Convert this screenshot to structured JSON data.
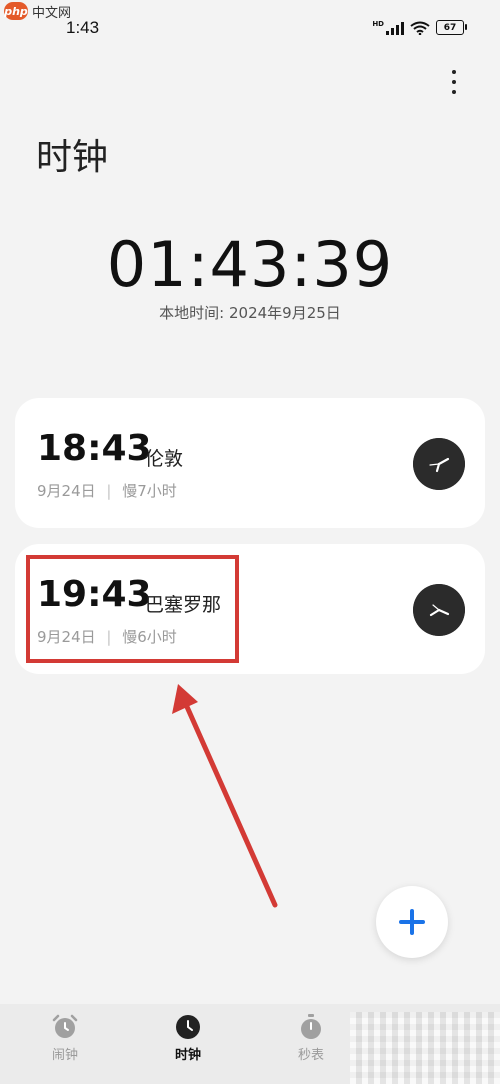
{
  "watermark": {
    "logo": "php",
    "text": "中文网"
  },
  "status_bar": {
    "time": "1:43",
    "hd": "HD",
    "battery": "67"
  },
  "header": {
    "title": "时钟",
    "more_icon": "more-vertical-icon"
  },
  "local_clock": {
    "time": "01:43:39",
    "date": "本地时间: 2024年9月25日"
  },
  "world_clocks": [
    {
      "time": "18:43",
      "city": "伦敦",
      "date": "9月24日",
      "separator": "|",
      "offset": "慢7小时"
    },
    {
      "time": "19:43",
      "city": "巴塞罗那",
      "date": "9月24日",
      "separator": "|",
      "offset": "慢6小时"
    }
  ],
  "add_button": {
    "icon": "plus-icon"
  },
  "colors": {
    "accent": "#1a73e8",
    "annotation": "#d33a35",
    "background": "#f3f3f3",
    "card": "#ffffff"
  },
  "bottom_nav": [
    {
      "label": "闹钟",
      "icon": "alarm-clock-icon",
      "active": false
    },
    {
      "label": "时钟",
      "icon": "clock-icon",
      "active": true
    },
    {
      "label": "秒表",
      "icon": "stopwatch-icon",
      "active": false
    }
  ]
}
